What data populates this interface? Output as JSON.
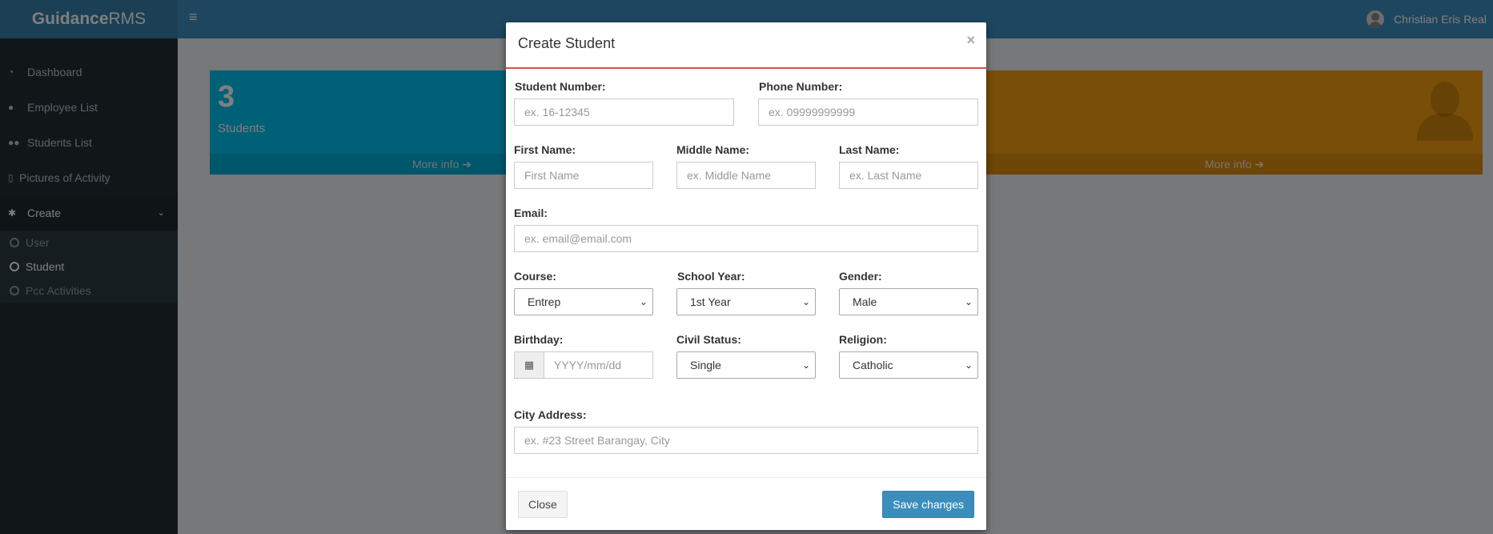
{
  "app": {
    "brand_bold": "Guidance",
    "brand_light": "RMS",
    "user_name": "Christian Eris Real"
  },
  "sidebar": {
    "items": [
      {
        "label": "Dashboard",
        "icon": "dashboard-icon"
      },
      {
        "label": "Employee List",
        "icon": "user-icon"
      },
      {
        "label": "Students List",
        "icon": "users-icon"
      },
      {
        "label": "Pictures of Activity",
        "icon": "image-icon"
      },
      {
        "label": "Create",
        "icon": "gear-icon"
      }
    ],
    "submenu": [
      {
        "label": "User"
      },
      {
        "label": "Student"
      },
      {
        "label": "Pcc Activities"
      }
    ]
  },
  "dashboard": {
    "students_count": "3",
    "students_label": "Students",
    "more_info_left": "More info",
    "more_info_right": "More info"
  },
  "modal": {
    "title": "Create Student",
    "close_symbol": "×",
    "fields": {
      "student_number": {
        "label": "Student Number:",
        "placeholder": "ex. 16-12345"
      },
      "phone_number": {
        "label": "Phone Number:",
        "placeholder": "ex. 09999999999"
      },
      "first_name": {
        "label": "First Name:",
        "placeholder": "First Name"
      },
      "middle_name": {
        "label": "Middle Name:",
        "placeholder": "ex. Middle Name"
      },
      "last_name": {
        "label": "Last Name:",
        "placeholder": "ex. Last Name"
      },
      "email": {
        "label": "Email:",
        "placeholder": "ex. email@email.com"
      },
      "course": {
        "label": "Course:",
        "value": "Entrep"
      },
      "school_year": {
        "label": "School Year:",
        "value": "1st Year"
      },
      "gender": {
        "label": "Gender:",
        "value": "Male"
      },
      "birthday": {
        "label": "Birthday:",
        "placeholder": "YYYY/mm/dd"
      },
      "civil_status": {
        "label": "Civil Status:",
        "value": "Single"
      },
      "religion": {
        "label": "Religion:",
        "value": "Catholic"
      },
      "city_address": {
        "label": "City Address:",
        "placeholder": "ex. #23 Street Barangay, City"
      }
    },
    "close_button": "Close",
    "save_button": "Save changes"
  },
  "colors": {
    "header": "#3c8dbc",
    "sidebar": "#222d32",
    "info_blue": "#00c0ef",
    "info_orange": "#f39c12",
    "modal_accent": "#d9534f"
  }
}
